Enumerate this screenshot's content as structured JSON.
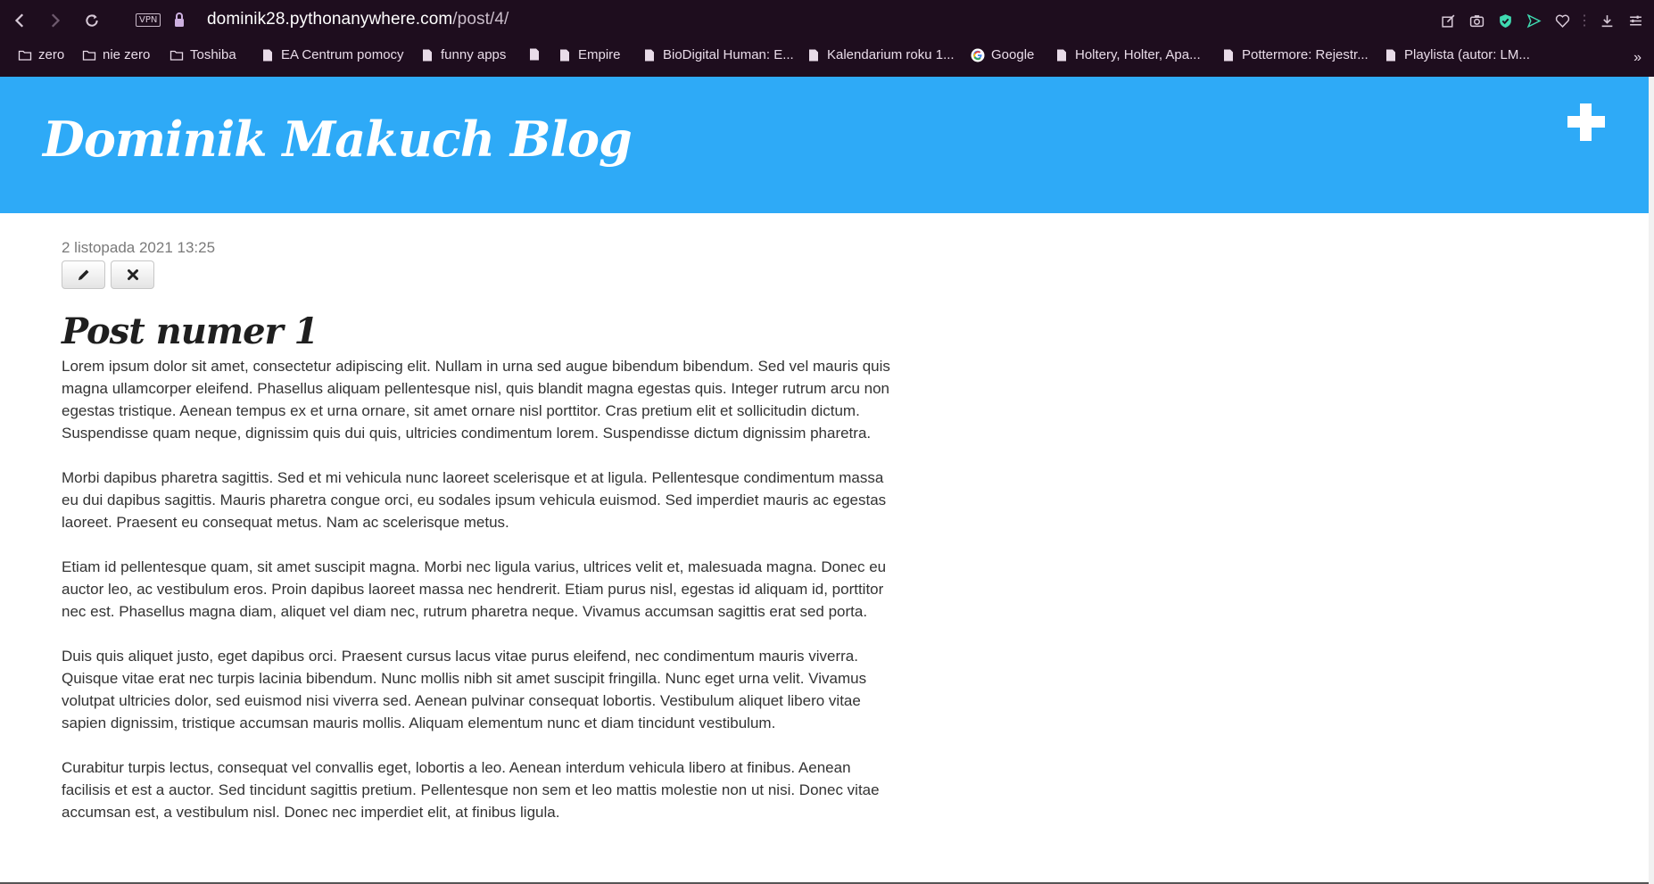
{
  "browser": {
    "vpn_label": "VPN",
    "url_domain": "dominik28.pythonanywhere.com",
    "url_path": "/post/4/",
    "bookmarks": [
      {
        "label": "zero",
        "icon": "folder-icon"
      },
      {
        "label": "nie zero",
        "icon": "folder-icon"
      },
      {
        "label": "Toshiba",
        "icon": "folder-icon"
      },
      {
        "label": "EA Centrum pomocy",
        "icon": "page-icon"
      },
      {
        "label": "funny apps",
        "icon": "page-icon"
      },
      {
        "label": "",
        "icon": "page-icon"
      },
      {
        "label": "Empire",
        "icon": "page-icon"
      },
      {
        "label": "BioDigital Human: E...",
        "icon": "page-icon"
      },
      {
        "label": "Kalendarium roku 1...",
        "icon": "page-icon"
      },
      {
        "label": "Google",
        "icon": "google-icon"
      },
      {
        "label": "Holtery, Holter, Apa...",
        "icon": "page-icon"
      },
      {
        "label": "Pottermore: Rejestr...",
        "icon": "page-icon"
      },
      {
        "label": "Playlista (autor: LM...",
        "icon": "page-icon"
      }
    ],
    "more_bookmarks": "»"
  },
  "header": {
    "title": "Dominik Makuch Blog",
    "accent_color": "#2eaaf7"
  },
  "post": {
    "date": "2 listopada 2021 13:25",
    "title": "Post numer 1",
    "paragraphs": [
      "Lorem ipsum dolor sit amet, consectetur adipiscing elit. Nullam in urna sed augue bibendum bibendum. Sed vel mauris quis magna ullamcorper eleifend. Phasellus aliquam pellentesque nisl, quis blandit magna egestas quis. Integer rutrum arcu non egestas tristique. Aenean tempus ex et urna ornare, sit amet ornare nisl porttitor. Cras pretium elit et sollicitudin dictum. Suspendisse quam neque, dignissim quis dui quis, ultricies condimentum lorem. Suspendisse dictum dignissim pharetra.",
      "Morbi dapibus pharetra sagittis. Sed et mi vehicula nunc laoreet scelerisque et at ligula. Pellentesque condimentum massa eu dui dapibus sagittis. Mauris pharetra congue orci, eu sodales ipsum vehicula euismod. Sed imperdiet mauris ac egestas laoreet. Praesent eu consequat metus. Nam ac scelerisque metus.",
      "Etiam id pellentesque quam, sit amet suscipit magna. Morbi nec ligula varius, ultrices velit et, malesuada magna. Donec eu auctor leo, ac vestibulum eros. Proin dapibus laoreet massa nec hendrerit. Etiam purus nisl, egestas id aliquam id, porttitor nec est. Phasellus magna diam, aliquet vel diam nec, rutrum pharetra neque. Vivamus accumsan sagittis erat sed porta.",
      "Duis quis aliquet justo, eget dapibus orci. Praesent cursus lacus vitae purus eleifend, nec condimentum mauris viverra. Quisque vitae erat nec turpis lacinia bibendum. Nunc mollis nibh sit amet suscipit fringilla. Nunc eget urna velit. Vivamus volutpat ultricies dolor, sed euismod nisi viverra sed. Aenean pulvinar consequat lobortis. Vestibulum aliquet libero vitae sapien dignissim, tristique accumsan mauris mollis. Aliquam elementum nunc et diam tincidunt vestibulum.",
      "Curabitur turpis lectus, consequat vel convallis eget, lobortis a leo. Aenean interdum vehicula libero at finibus. Aenean facilisis et est a auctor. Sed tincidunt sagittis pretium. Pellentesque non sem et leo mattis molestie non ut nisi. Donec vitae accumsan est, a vestibulum nisl. Donec nec imperdiet elit, at finibus ligula."
    ]
  }
}
